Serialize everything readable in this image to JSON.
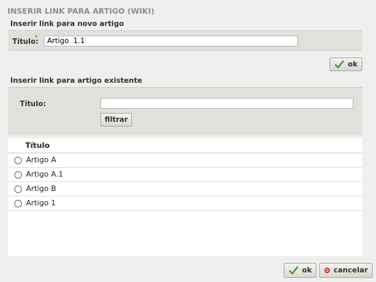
{
  "dialog": {
    "title": "INSERIR LINK PARA ARTIGO (WIKI)"
  },
  "new_article": {
    "heading": "Inserir link para novo artigo",
    "title_label": "Título:",
    "title_value": "Artigo  1.1",
    "ok_label": "ok"
  },
  "existing_article": {
    "heading": "Inserir link para artigo existente",
    "title_label": "Título:",
    "title_value": "",
    "filter_label": "filtrar",
    "list_header": "Título",
    "items": [
      "Artigo A",
      "Artigo A.1",
      "Artigo B",
      "Artigo 1"
    ]
  },
  "footer": {
    "ok_label": "ok",
    "cancel_label": "cancelar"
  },
  "colors": {
    "required_marker": "#f0a020",
    "ok_check": "#3a9a2a",
    "cancel_red": "#d03020"
  }
}
